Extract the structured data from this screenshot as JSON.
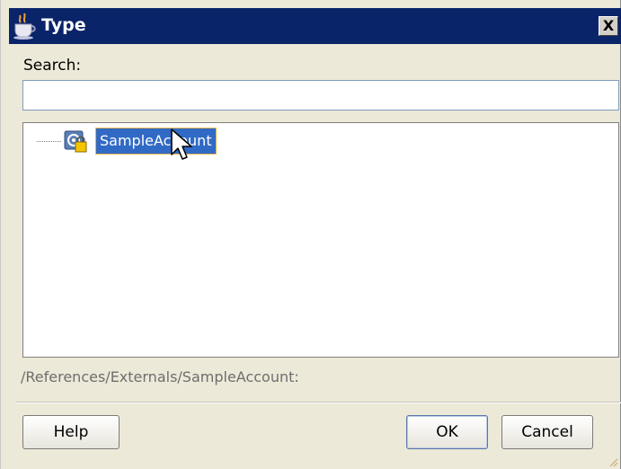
{
  "dialog": {
    "title": "Type",
    "close_glyph": "X"
  },
  "search": {
    "label": "Search:",
    "value": "",
    "placeholder": ""
  },
  "tree": {
    "items": [
      {
        "label": "SampleAccount",
        "icon": "schema-element-icon",
        "selected": true
      }
    ]
  },
  "path_text": "/References/Externals/SampleAccount:",
  "buttons": {
    "help": "Help",
    "ok": "OK",
    "cancel": "Cancel"
  },
  "colors": {
    "title_bar": "#0a246a",
    "selection": "#316ac5",
    "dialog_bg": "#ece9d8"
  }
}
